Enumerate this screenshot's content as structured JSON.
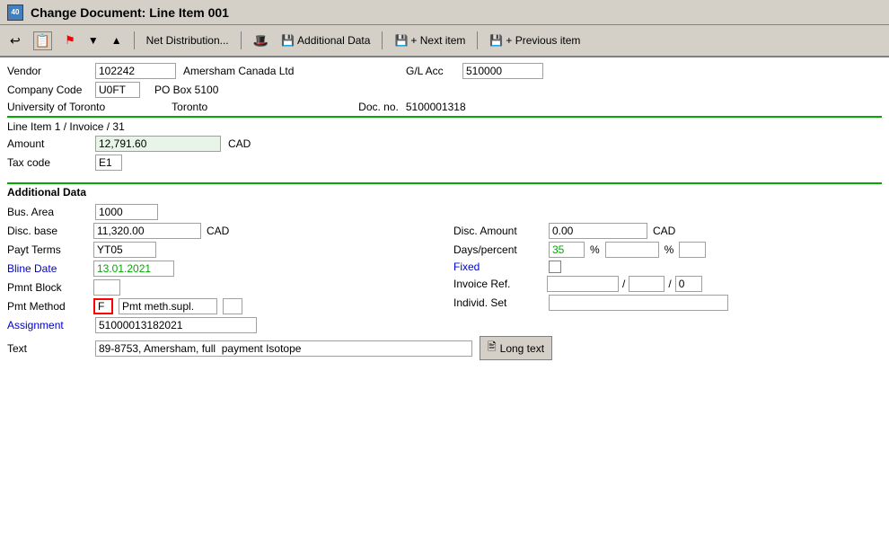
{
  "title_bar": {
    "icon_label": "40",
    "title": "Change Document: Line Item 001"
  },
  "toolbar": {
    "btn1_label": "",
    "btn2_label": "",
    "btn3_label": "",
    "btn4_label": "",
    "btn5_label": "",
    "net_distribution": "Net Distribution...",
    "additional_data": "Additional Data",
    "next_item": "+ Next item",
    "previous_item": "+ Previous item"
  },
  "header": {
    "vendor_label": "Vendor",
    "vendor_value": "102242",
    "vendor_name": "Amersham Canada Ltd",
    "gl_acc_label": "G/L Acc",
    "gl_acc_value": "510000",
    "company_code_label": "Company Code",
    "company_code_value": "U0FT",
    "po_box": "PO Box 5100",
    "university": "University of Toronto",
    "city": "Toronto",
    "doc_no_label": "Doc. no.",
    "doc_no_value": "5100001318",
    "line_item_info": "Line Item 1 / Invoice / 31"
  },
  "line_item": {
    "amount_label": "Amount",
    "amount_value": "12,791.60",
    "amount_currency": "CAD",
    "tax_code_label": "Tax code",
    "tax_code_value": "E1"
  },
  "additional_data_section": {
    "section_label": "Additional Data",
    "bus_area_label": "Bus. Area",
    "bus_area_value": "1000",
    "disc_base_label": "Disc. base",
    "disc_base_value": "11,320.00",
    "disc_base_currency": "CAD",
    "disc_amount_label": "Disc. Amount",
    "disc_amount_value": "0.00",
    "disc_amount_currency": "CAD",
    "payt_terms_label": "Payt Terms",
    "payt_terms_value": "YT05",
    "days_percent_label": "Days/percent",
    "days_value": "35",
    "percent_value": "",
    "percent_value2": "",
    "bline_date_label": "Bline Date",
    "bline_date_value": "13.01.2021",
    "fixed_label": "Fixed",
    "pmnt_block_label": "Pmnt Block",
    "pmnt_block_value": "",
    "invoice_ref_label": "Invoice Ref.",
    "invoice_ref_value": "",
    "invoice_ref_mid": "",
    "invoice_ref_end": "0",
    "pmt_method_label": "Pmt Method",
    "pmt_method_code": "F",
    "pmt_method_desc": "Pmt meth.supl.",
    "pmt_method_extra": "",
    "individ_set_label": "Individ. Set",
    "individ_set_value": "",
    "assignment_label": "Assignment",
    "assignment_value": "51000013182021",
    "text_label": "Text",
    "text_value": "89-8753, Amersham, full  payment Isotope",
    "long_text_btn": "Long text"
  }
}
